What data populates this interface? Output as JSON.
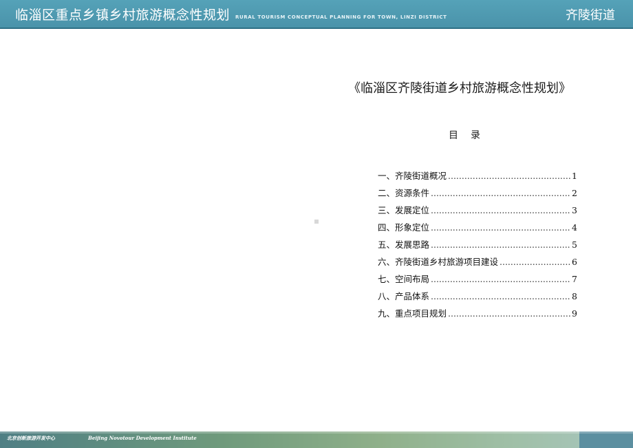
{
  "header": {
    "title_cn": "临淄区重点乡镇乡村旅游概念性规划",
    "title_en": "RURAL TOURISM CONCEPTUAL PLANNING FOR TOWN, LINZI DISTRICT",
    "district": "齐陵街道"
  },
  "document": {
    "title": "《临淄区齐陵街道乡村旅游概念性规划》",
    "toc_heading": "目　录",
    "toc": [
      {
        "label": "一、齐陵街道概况",
        "page": "1"
      },
      {
        "label": "二、资源条件",
        "page": "2"
      },
      {
        "label": "三、发展定位",
        "page": "3"
      },
      {
        "label": "四、形象定位",
        "page": "4"
      },
      {
        "label": "五、发展思路",
        "page": "5"
      },
      {
        "label": "六、齐陵街道乡村旅游项目建设",
        "page": "6"
      },
      {
        "label": "七、空间布局",
        "page": "7"
      },
      {
        "label": "八、产品体系",
        "page": "8"
      },
      {
        "label": "九、重点项目规划",
        "page": "9"
      }
    ]
  },
  "footer": {
    "org_cn": "北京创新旅游开发中心",
    "org_en": "Beijing Novotour Development Institute"
  }
}
